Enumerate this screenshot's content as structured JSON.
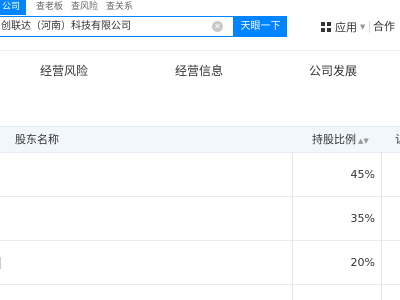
{
  "tabs": [
    "公司",
    "查老板",
    "查风险",
    "查关系"
  ],
  "search": {
    "value": "创联达（河南）科技有限公司",
    "button_label": "天眼一下"
  },
  "header": {
    "apps_label": "应用",
    "coop_label": "合作"
  },
  "nav": [
    "经营风险",
    "经营信息",
    "公司发展"
  ],
  "table": {
    "headers": {
      "name": "股东名称",
      "ratio": "持股比例",
      "partial": "认"
    },
    "rows": [
      {
        "percent": "45%"
      },
      {
        "percent": "35%"
      },
      {
        "percent": "20%"
      }
    ]
  }
}
